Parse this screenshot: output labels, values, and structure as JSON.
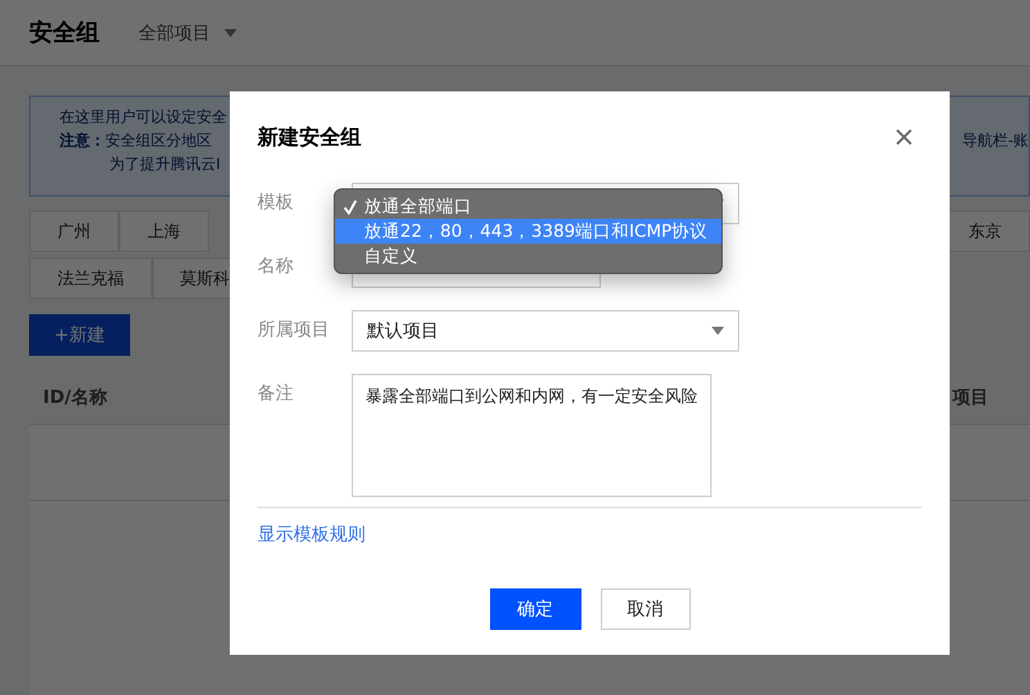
{
  "header": {
    "title": "安全组",
    "project_filter": "全部项目"
  },
  "notice": {
    "line_1": "在这里用户可以设定安全",
    "note_label": "注意：",
    "line_2": "安全组区分地区",
    "line_3": "为了提升腾讯云I",
    "right_text": "导航栏-账"
  },
  "region_rows": [
    {
      "left": [
        "广州",
        "上海"
      ],
      "right": [
        "东京"
      ]
    },
    {
      "left": [
        "法兰克福",
        "莫斯科"
      ],
      "right": []
    }
  ],
  "new_button": "+新建",
  "table": {
    "columns": [
      "ID/名称",
      "项目"
    ]
  },
  "dialog": {
    "title": "新建安全组",
    "fields": [
      {
        "kind": "select",
        "label": "模板"
      },
      {
        "kind": "input",
        "label": "名称"
      },
      {
        "kind": "select",
        "label": "所属项目",
        "value": "默认项目"
      },
      {
        "kind": "textarea",
        "label": "备注",
        "value": "暴露全部端口到公网和内网，有一定安全风险"
      }
    ],
    "template_menu": [
      {
        "label": "放通全部端口",
        "selected": true,
        "highlighted": false
      },
      {
        "label": "放通22，80，443，3389端口和ICMP协议",
        "selected": false,
        "highlighted": true
      },
      {
        "label": "自定义",
        "selected": false,
        "highlighted": false
      }
    ],
    "link": "显示模板规则",
    "buttons": [
      {
        "label": "确定",
        "kind": "primary"
      },
      {
        "label": "取消",
        "kind": "secondary"
      }
    ]
  }
}
